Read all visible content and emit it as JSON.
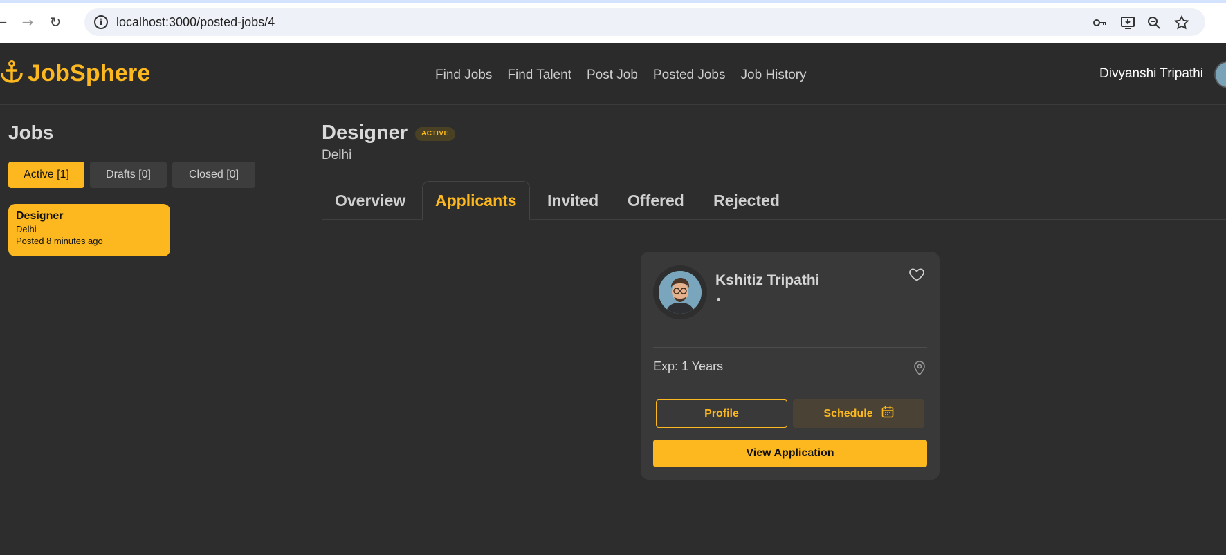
{
  "browser": {
    "url": "localhost:3000/posted-jobs/4",
    "icons": [
      "back-icon",
      "forward-icon",
      "reload-icon",
      "site-info-icon",
      "password-key-icon",
      "install-app-icon",
      "zoom-icon",
      "bookmark-star-icon"
    ]
  },
  "header": {
    "logo_text": "JobSphere",
    "nav": [
      {
        "label": "Find Jobs"
      },
      {
        "label": "Find Talent"
      },
      {
        "label": "Post Job"
      },
      {
        "label": "Posted Jobs"
      },
      {
        "label": "Job History"
      }
    ],
    "user_name": "Divyanshi Tripathi"
  },
  "sidebar": {
    "title": "Jobs",
    "filters": [
      {
        "label": "Active [1]",
        "active": true
      },
      {
        "label": "Drafts [0]",
        "active": false
      },
      {
        "label": "Closed [0]",
        "active": false
      }
    ],
    "jobs": [
      {
        "title": "Designer",
        "location": "Delhi",
        "posted": "Posted 8 minutes ago"
      }
    ]
  },
  "main": {
    "title": "Designer",
    "status": "ACTIVE",
    "location": "Delhi",
    "tabs": [
      {
        "label": "Overview",
        "selected": false
      },
      {
        "label": "Applicants",
        "selected": true
      },
      {
        "label": "Invited",
        "selected": false
      },
      {
        "label": "Offered",
        "selected": false
      },
      {
        "label": "Rejected",
        "selected": false
      }
    ]
  },
  "applicant": {
    "name": "Kshitiz Tripathi",
    "subtitle": "•",
    "experience": "Exp: 1 Years",
    "profile_label": "Profile",
    "schedule_label": "Schedule",
    "view_label": "View Application"
  },
  "colors": {
    "accent": "#fcb81e",
    "background": "#2d2d2d",
    "card": "#393939"
  }
}
